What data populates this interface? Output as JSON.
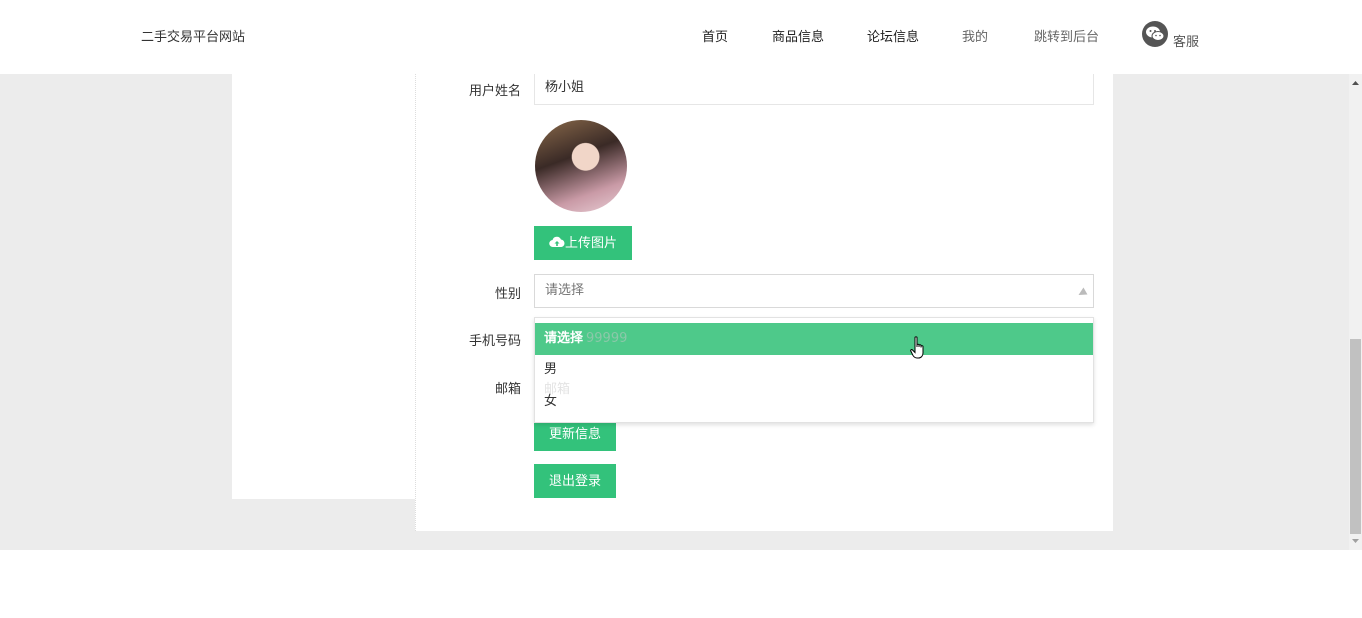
{
  "header": {
    "site_title": "二手交易平台网站",
    "nav": [
      "首页",
      "商品信息",
      "论坛信息",
      "我的",
      "跳转到后台"
    ],
    "service_label": "客服"
  },
  "form": {
    "username_label": "用户姓名",
    "username_value": "杨小姐",
    "upload_label": "上传图片",
    "gender_label": "性别",
    "gender_placeholder": "请选择",
    "phone_label": "手机号码",
    "email_label": "邮箱",
    "update_label": "更新信息",
    "logout_label": "退出登录"
  },
  "dropdown": {
    "options": [
      "请选择",
      "男",
      "女"
    ],
    "ghost_phone": "99999",
    "ghost_email": "邮箱"
  },
  "colors": {
    "accent": "#33c27b",
    "highlight": "#4ec98a"
  }
}
